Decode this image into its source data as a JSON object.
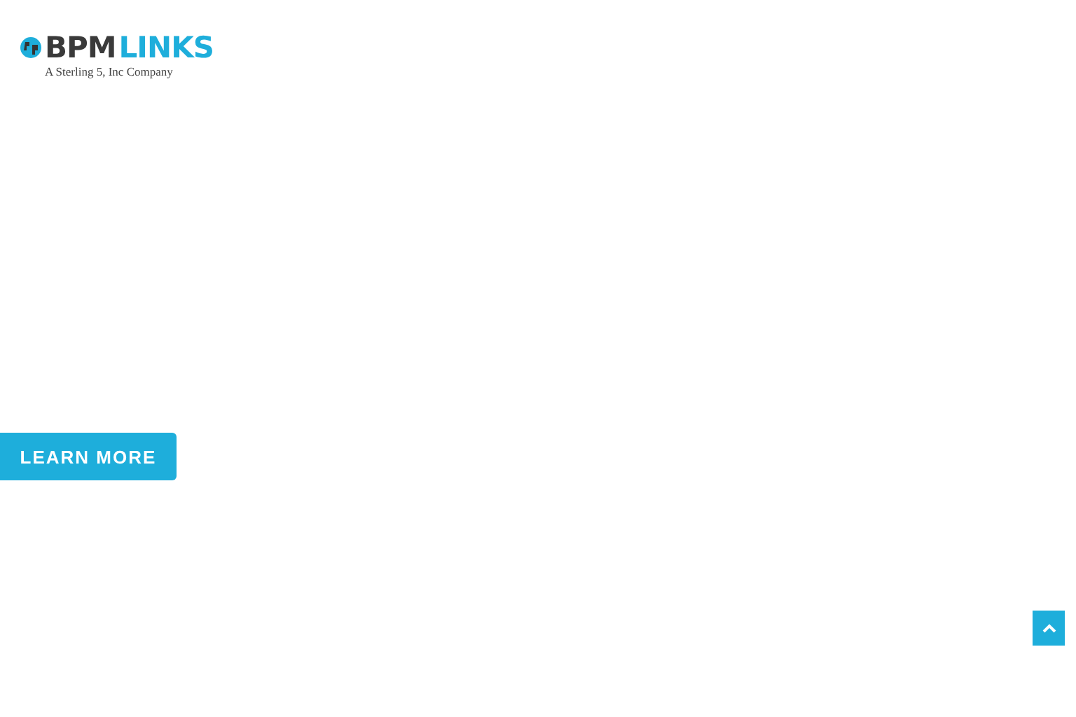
{
  "logo": {
    "part_1": "BPM",
    "part_2": "LINKS",
    "tagline": "A Sterling 5, Inc Company"
  },
  "cta": {
    "label": "LEARN MORE"
  }
}
